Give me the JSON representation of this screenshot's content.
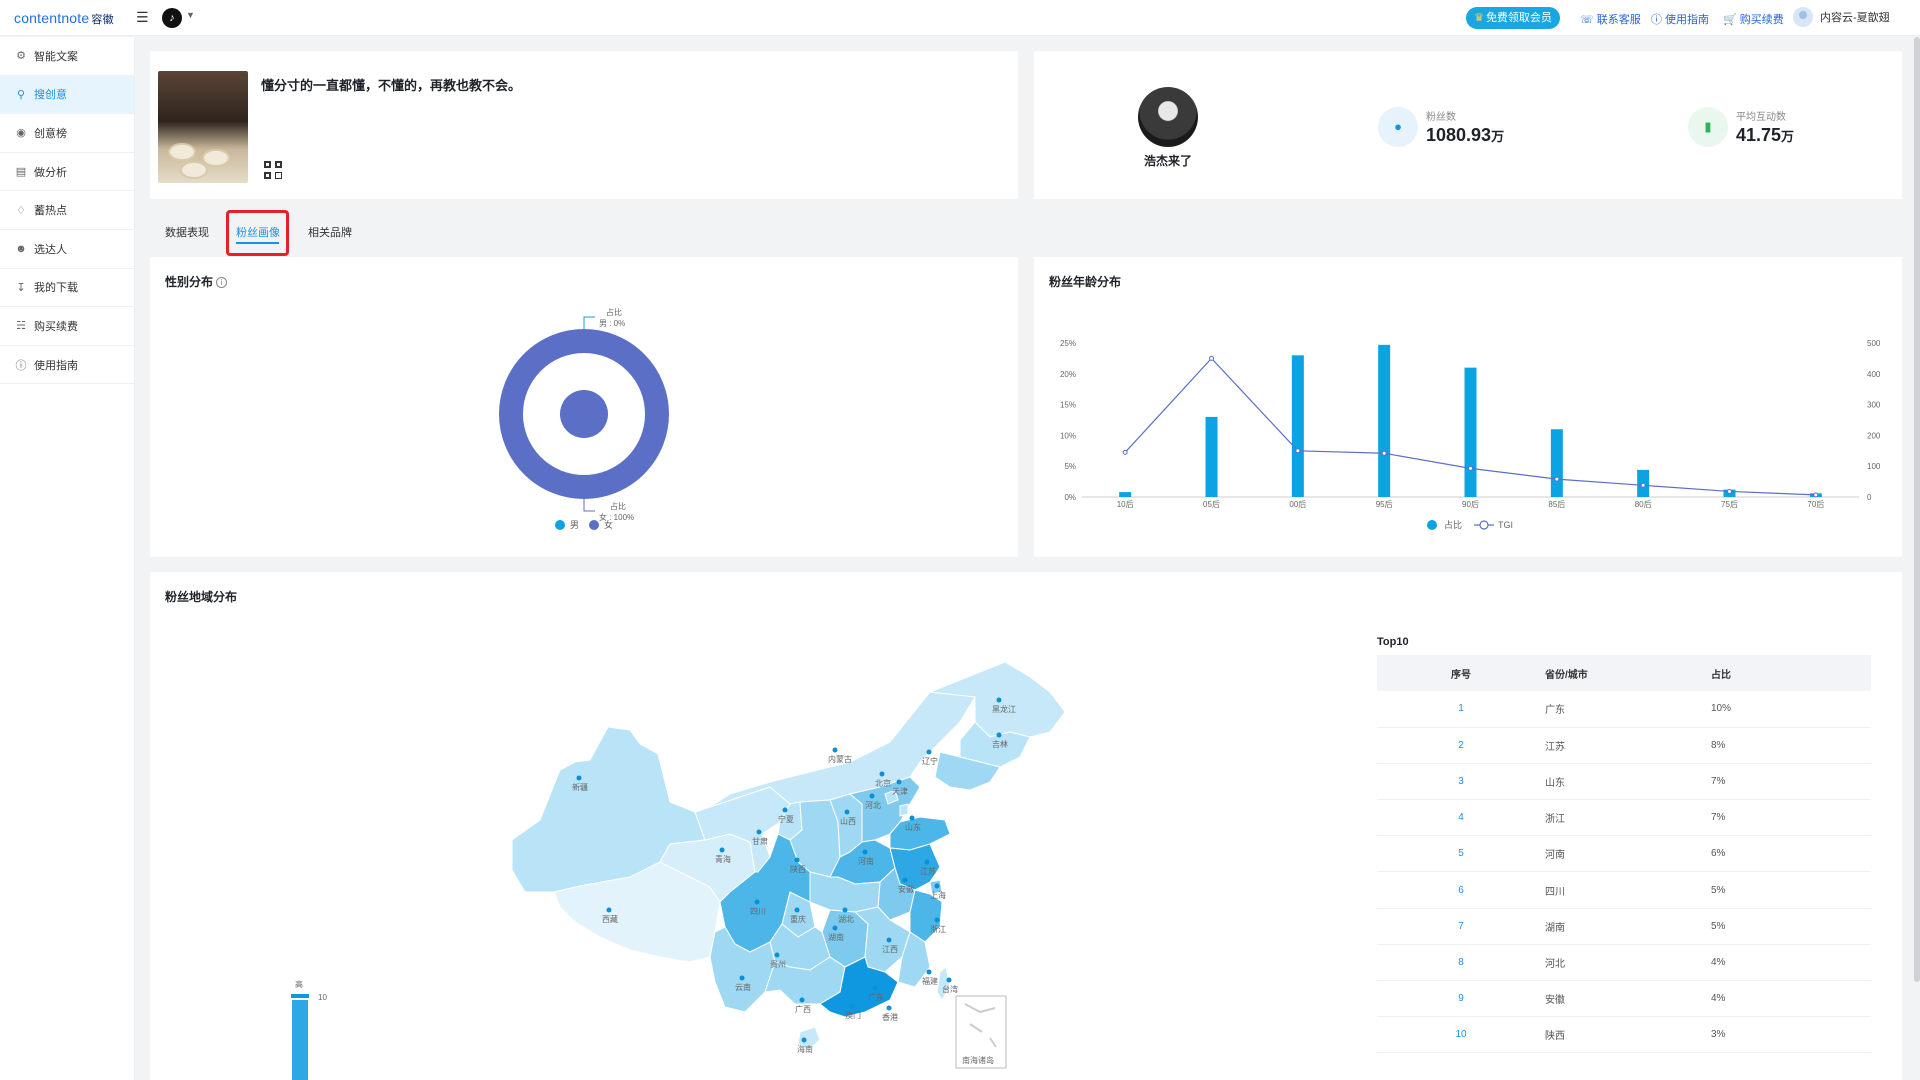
{
  "header": {
    "logo_text": "contentnote",
    "logo_cn": "容徽",
    "vip_button": "免费领取会员",
    "nav": [
      {
        "label": "联系客服",
        "icon": "headset-icon"
      },
      {
        "label": "使用指南",
        "icon": "help-circle-icon"
      },
      {
        "label": "购买续费",
        "icon": "cart-icon"
      }
    ],
    "user_name": "内容云-夏歆翅"
  },
  "sidebar": {
    "items": [
      {
        "label": "智能文案",
        "icon": "ai-copy-icon"
      },
      {
        "label": "搜创意",
        "icon": "search-idea-icon",
        "active": true
      },
      {
        "label": "创意榜",
        "icon": "ranking-icon"
      },
      {
        "label": "做分析",
        "icon": "bar-chart-icon"
      },
      {
        "label": "蓄热点",
        "icon": "hotspot-icon"
      },
      {
        "label": "选达人",
        "icon": "person-icon"
      },
      {
        "label": "我的下载",
        "icon": "download-icon"
      },
      {
        "label": "购买续费",
        "icon": "cart-icon"
      },
      {
        "label": "使用指南",
        "icon": "help-circle-icon"
      }
    ]
  },
  "video": {
    "title": "懂分寸的一直都懂，不懂的，再教也教不会。"
  },
  "profile": {
    "name": "浩杰来了",
    "fans_label": "粉丝数",
    "fans_value": "1080.93",
    "fans_unit": "万",
    "interact_label": "平均互动数",
    "interact_value": "41.75",
    "interact_unit": "万"
  },
  "tabs": [
    {
      "label": "数据表现"
    },
    {
      "label": "粉丝画像",
      "active": true
    },
    {
      "label": "相关品牌"
    }
  ],
  "gender": {
    "title": "性别分布",
    "male_label": "占比\n男 : 0%",
    "female_label": "占比\n女 : 100%",
    "top_line1": "占比",
    "top_line2": "男 : 0%",
    "bottom_line1": "占比",
    "bottom_line2": "女 : 100%",
    "legend_male": "男",
    "legend_female": "女",
    "colors": {
      "male": "#0ca3e3",
      "female": "#5b6fc6"
    }
  },
  "chart_data": [
    {
      "type": "pie",
      "title": "性别分布",
      "categories": [
        "男",
        "女"
      ],
      "values": [
        0,
        100
      ],
      "unit": "%"
    },
    {
      "type": "bar",
      "title": "粉丝年龄分布",
      "categories": [
        "10后",
        "05后",
        "00后",
        "95后",
        "90后",
        "85后",
        "80后",
        "75后",
        "70后"
      ],
      "series": [
        {
          "name": "占比",
          "type": "bar",
          "axis": "left",
          "values": [
            0.8,
            13,
            23,
            24.7,
            21,
            11,
            4.4,
            1.2,
            0.6
          ]
        },
        {
          "name": "TGI",
          "type": "line",
          "axis": "right",
          "values": [
            145,
            450,
            150,
            142,
            93,
            58,
            38,
            18,
            7
          ]
        }
      ],
      "y_left_ticks": [
        "0%",
        "5%",
        "10%",
        "15%",
        "20%",
        "25%"
      ],
      "ylim_left": [
        0,
        25
      ],
      "y_right_ticks": [
        "0",
        "100",
        "200",
        "300",
        "400",
        "500"
      ],
      "ylim_right": [
        0,
        500
      ],
      "colors": {
        "bar": "#0ca3e3",
        "line": "#5b6fc6"
      }
    },
    {
      "type": "table",
      "title": "Top10",
      "columns": [
        "序号",
        "省份/城市",
        "占比"
      ],
      "rows": [
        [
          "1",
          "广东",
          "10%"
        ],
        [
          "2",
          "江苏",
          "8%"
        ],
        [
          "3",
          "山东",
          "7%"
        ],
        [
          "4",
          "浙江",
          "7%"
        ],
        [
          "5",
          "河南",
          "6%"
        ],
        [
          "6",
          "四川",
          "5%"
        ],
        [
          "7",
          "湖南",
          "5%"
        ],
        [
          "8",
          "河北",
          "4%"
        ],
        [
          "9",
          "安徽",
          "4%"
        ],
        [
          "10",
          "陕西",
          "3%"
        ]
      ]
    }
  ],
  "age": {
    "title": "粉丝年龄分布",
    "legend_bar": "占比",
    "legend_line": "TGI"
  },
  "region": {
    "title": "粉丝地域分布",
    "legend_high": "高",
    "legend_value": "10",
    "south_sea_label": "南海诸岛",
    "top10_title": "Top10",
    "provinces": [
      "黑龙江",
      "吉林",
      "辽宁",
      "内蒙古",
      "北京",
      "天津",
      "河北",
      "山西",
      "山东",
      "宁夏",
      "甘肃",
      "青海",
      "新疆",
      "西藏",
      "陕西",
      "河南",
      "江苏",
      "安徽",
      "上海",
      "湖北",
      "四川",
      "重庆",
      "湖南",
      "江西",
      "浙江",
      "贵州",
      "福建",
      "云南",
      "广西",
      "广东",
      "澳门",
      "香港",
      "台湾",
      "海南"
    ]
  }
}
